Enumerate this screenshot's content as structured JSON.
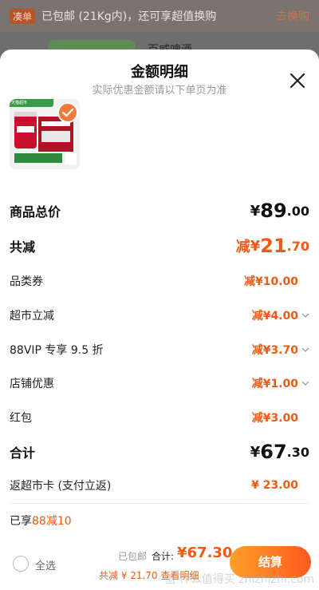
{
  "background": {
    "promo_tag": "凑单",
    "promo_text": "已包邮 (21Kg内)，还可享超值换购",
    "promo_link": "去换购",
    "product_title": "百威啤酒 ..."
  },
  "sheet": {
    "title": "金额明细",
    "subtitle": "实际优惠金额请以下单页为准"
  },
  "product": {
    "badge_text": "天猫超市"
  },
  "lines": {
    "goods_total": {
      "label": "商品总价",
      "yen": "¥",
      "int": "89",
      "dec": ".00"
    },
    "total_reduce": {
      "label": "共减",
      "prefix": "减",
      "yen": "¥",
      "int": "21",
      "dec": ".70"
    },
    "category_coupon": {
      "label": "品类券",
      "text": "减¥10.00"
    },
    "supermarket_reduce": {
      "label": "超市立减",
      "text": "减¥4.00"
    },
    "vip_discount": {
      "label": "88VIP 专享 9.5 折",
      "text": "减¥3.70"
    },
    "store_discount": {
      "label": "店铺优惠",
      "text": "减¥1.00"
    },
    "red_packet": {
      "label": "红包",
      "text": "减¥3.00"
    },
    "sum": {
      "label": "合计",
      "yen": "¥",
      "int": "67",
      "dec": ".30"
    },
    "card_rebate": {
      "label": "返超市卡 (支付立返)",
      "text": "¥ 23.00"
    },
    "promo_enjoyed": {
      "prefix": "已享",
      "text": "88减10"
    }
  },
  "bottom_bar": {
    "select_all": "全选",
    "free_shipping": "已包邮",
    "total_label": "合计:",
    "total_value": "¥67.30",
    "save_text": "共减 ¥ 21.70",
    "view_detail": "查看明细",
    "checkout": "结算"
  },
  "watermark": "值 什么值得买 zhizhizhi.com",
  "colors": {
    "accent": "#f05a14",
    "check": "#f07a3b"
  }
}
